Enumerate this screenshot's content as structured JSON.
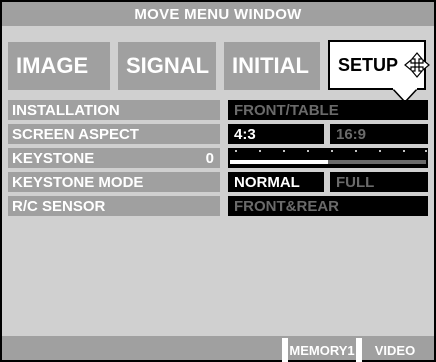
{
  "window": {
    "title": "MOVE MENU WINDOW"
  },
  "tabs": [
    {
      "label": "IMAGE",
      "active": false
    },
    {
      "label": "SIGNAL",
      "active": false
    },
    {
      "label": "INITIAL",
      "active": false
    },
    {
      "label": "SETUP",
      "active": true,
      "icon": "four-way-arrow-icon"
    }
  ],
  "rows": [
    {
      "label": "INSTALLATION",
      "value": "FRONT/TABLE"
    },
    {
      "label": "SCREEN ASPECT",
      "options": [
        "4:3",
        "16:9"
      ],
      "selected": "4:3"
    },
    {
      "label": "KEYSTONE",
      "number": "0",
      "slider_level": 0.5
    },
    {
      "label": "KEYSTONE MODE",
      "options": [
        "NORMAL",
        "FULL"
      ],
      "selected": "NORMAL"
    },
    {
      "label": "R/C SENSOR",
      "value": "FRONT&REAR"
    }
  ],
  "footer": {
    "memory": "MEMORY1",
    "source": "VIDEO"
  },
  "colors": {
    "label_bg": "#a0a0a0",
    "panel_bg": "#d0d0d0",
    "value_bg": "#000000",
    "dim_text": "#6a6a6a"
  }
}
